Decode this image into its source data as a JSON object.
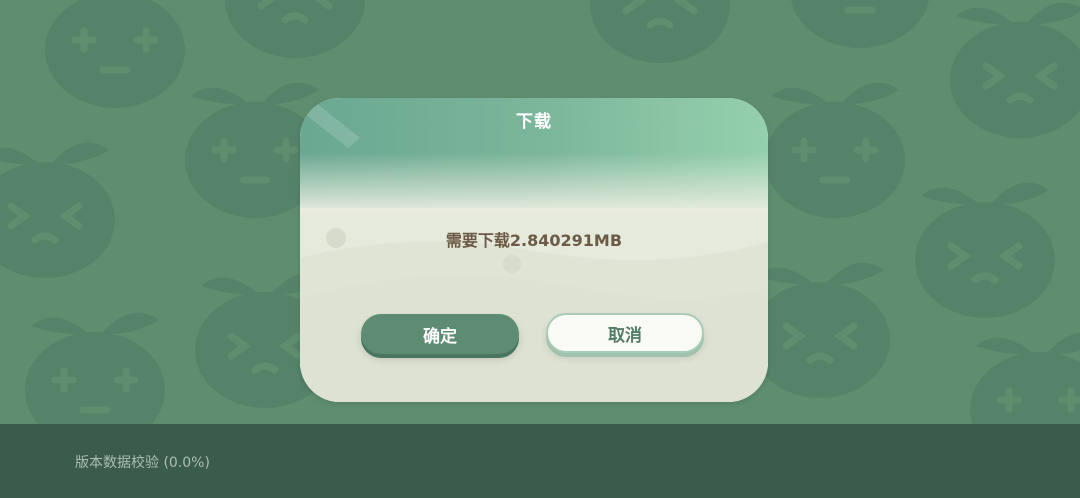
{
  "dialog": {
    "title": "下载",
    "message": "需要下载2.840291MB",
    "confirm_label": "确定",
    "cancel_label": "取消"
  },
  "status": {
    "text": "版本数据校验 (0.0%)",
    "progress": 0.0
  },
  "colors": {
    "background": "#5f8e6f",
    "status_bar": "#3b5b4d",
    "confirm_button": "#5d8c73",
    "cancel_button": "#fbfbf5",
    "message_text": "#6b5a45"
  },
  "background_pattern_icon": "fruit-face-icon"
}
